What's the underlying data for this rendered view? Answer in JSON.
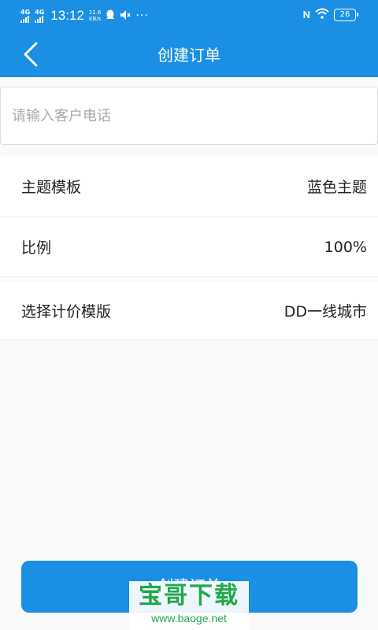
{
  "status_bar": {
    "network_1": "4G",
    "network_2": "4G",
    "time": "13:12",
    "speed_value": "11.6",
    "speed_unit": "KB/s",
    "overflow": "···",
    "nfc": "N",
    "battery": "26"
  },
  "header": {
    "title": "创建订单",
    "back_icon": "chevron-left-icon"
  },
  "phone_input": {
    "placeholder": "请输入客户电话",
    "value": ""
  },
  "rows": [
    {
      "label": "主题模板",
      "value": "蓝色主题"
    },
    {
      "label": "比例",
      "value": "100%"
    },
    {
      "label": "选择计价模版",
      "value": "DD一线城市"
    }
  ],
  "submit_label": "创建订单",
  "watermark": {
    "title": "宝哥下载",
    "url": "www.baoge.net"
  },
  "colors": {
    "primary": "#1a8fe3",
    "background": "#fafafa",
    "watermark": "#22a84a"
  }
}
